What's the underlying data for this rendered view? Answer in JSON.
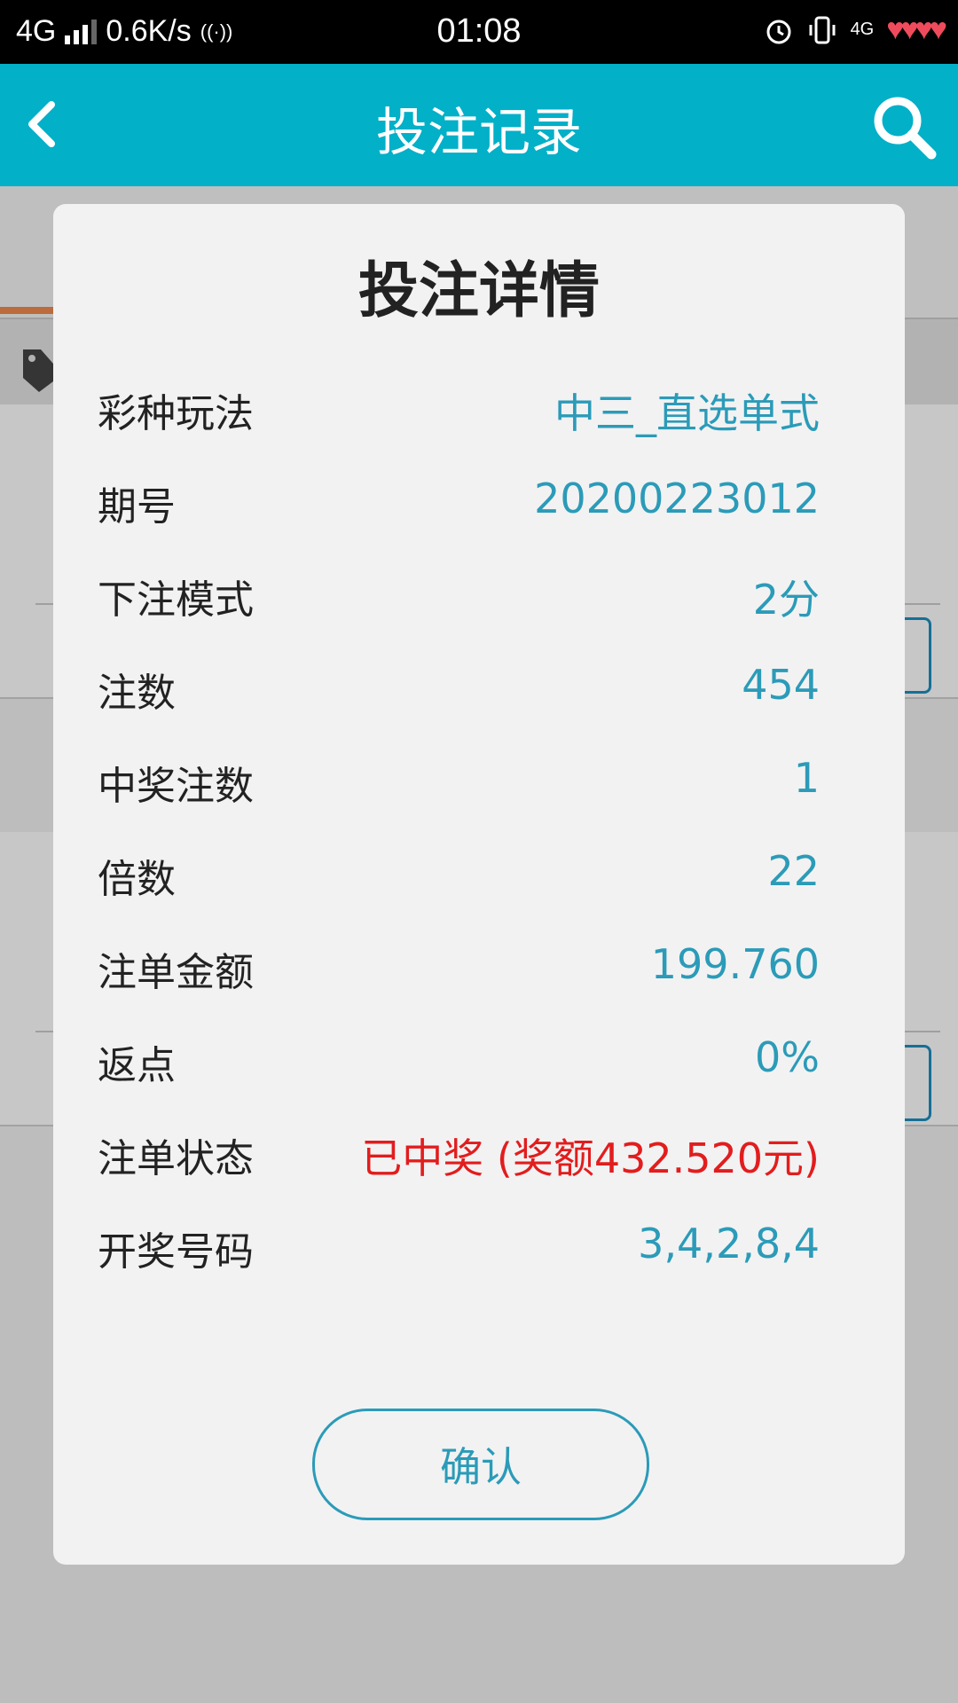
{
  "statusbar": {
    "network": "4G",
    "speed": "0.6K/s",
    "time": "01:08",
    "network_right": "4G"
  },
  "appbar": {
    "title": "投注记录"
  },
  "dialog": {
    "title": "投注详情",
    "rows": [
      {
        "label": "彩种玩法",
        "value": "中三_直选单式"
      },
      {
        "label": "期号",
        "value": "20200223012"
      },
      {
        "label": "下注模式",
        "value": "2分"
      },
      {
        "label": "注数",
        "value": "454"
      },
      {
        "label": "中奖注数",
        "value": "1"
      },
      {
        "label": "倍数",
        "value": "22"
      },
      {
        "label": "注单金额",
        "value": "199.760"
      },
      {
        "label": "返点",
        "value": "0%"
      },
      {
        "label": "注单状态",
        "value": "已中奖 (奖额432.520元)"
      },
      {
        "label": "开奖号码",
        "value": "3,4,2,8,4"
      }
    ],
    "confirm_label": "确认"
  },
  "colors": {
    "appbar": "#02b0c8",
    "value_text": "#2b9bb8",
    "status_won": "#e21d1d",
    "tab_active": "#f08a50"
  }
}
